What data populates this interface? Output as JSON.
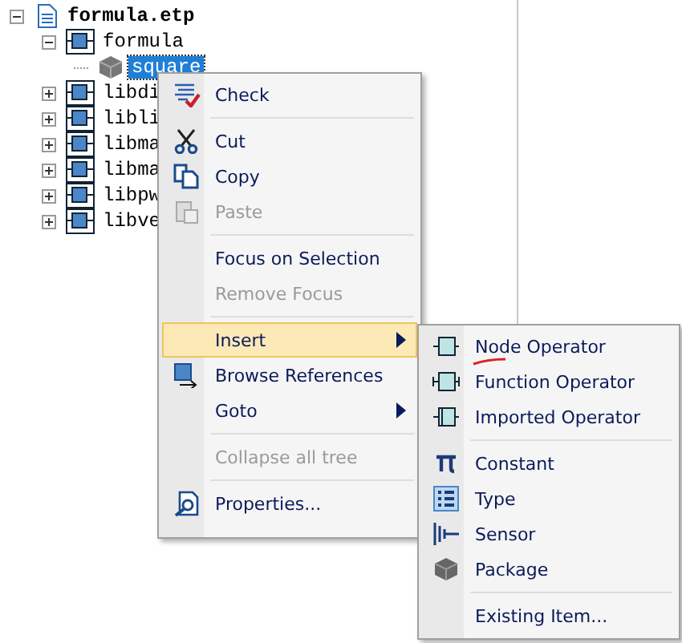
{
  "tree": {
    "label": "formula.etp",
    "kind": "project",
    "expanded": true,
    "children": [
      {
        "label": "formula",
        "kind": "operator",
        "expanded": true,
        "children": [
          {
            "label": "square",
            "kind": "package",
            "selected": true
          }
        ]
      },
      {
        "label": "libdi",
        "kind": "operator",
        "expanded": false
      },
      {
        "label": "libli",
        "kind": "operator",
        "expanded": false
      },
      {
        "label": "libma",
        "kind": "operator",
        "expanded": false
      },
      {
        "label": "libma",
        "kind": "operator",
        "expanded": false
      },
      {
        "label": "libpw",
        "kind": "operator",
        "expanded": false
      },
      {
        "label": "libve",
        "kind": "operator",
        "expanded": false
      }
    ]
  },
  "context_menu": {
    "items": [
      {
        "kind": "item",
        "label": "Check",
        "disabled": false
      },
      {
        "kind": "separator"
      },
      {
        "kind": "item",
        "label": "Cut",
        "disabled": false
      },
      {
        "kind": "item",
        "label": "Copy",
        "disabled": false
      },
      {
        "kind": "item",
        "label": "Paste",
        "disabled": true
      },
      {
        "kind": "separator"
      },
      {
        "kind": "item",
        "label": "Focus on Selection",
        "disabled": false
      },
      {
        "kind": "item",
        "label": "Remove Focus",
        "disabled": true
      },
      {
        "kind": "separator"
      },
      {
        "kind": "item",
        "label": "Insert",
        "submenu": true,
        "selected": true,
        "disabled": false
      },
      {
        "kind": "item",
        "label": "Browse References",
        "disabled": false
      },
      {
        "kind": "item",
        "label": "Goto",
        "submenu": true,
        "selected": false,
        "disabled": false
      },
      {
        "kind": "separator"
      },
      {
        "kind": "item",
        "label": "Collapse all tree",
        "disabled": true
      },
      {
        "kind": "separator"
      },
      {
        "kind": "item",
        "label": "Properties...",
        "disabled": false
      }
    ]
  },
  "submenu": {
    "items": [
      {
        "kind": "item",
        "label": "Node Operator",
        "underlined": true
      },
      {
        "kind": "item",
        "label": "Function Operator"
      },
      {
        "kind": "item",
        "label": "Imported Operator"
      },
      {
        "kind": "separator"
      },
      {
        "kind": "item",
        "label": "Constant"
      },
      {
        "kind": "item",
        "label": "Type"
      },
      {
        "kind": "item",
        "label": "Sensor"
      },
      {
        "kind": "item",
        "label": "Package"
      },
      {
        "kind": "separator"
      },
      {
        "kind": "item",
        "label": "Existing Item..."
      }
    ]
  }
}
